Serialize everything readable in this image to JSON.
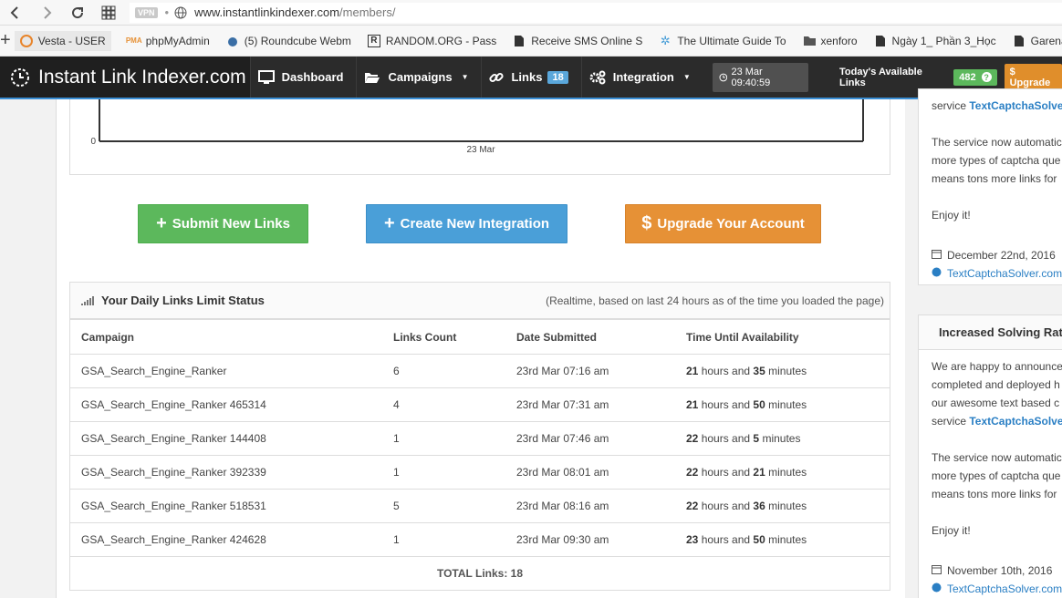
{
  "browser": {
    "vpn_label": "VPN",
    "url_host": "www.instantlinkindexer.com",
    "url_path": "/members/",
    "bookmarks": [
      "Vesta - USER",
      "phpMyAdmin",
      "(5) Roundcube Webm",
      "RANDOM.ORG - Pass",
      "Receive SMS Online S",
      "The Ultimate Guide To",
      "xenforo",
      "Ngày 1_ Phần 3_Học",
      "Garena"
    ]
  },
  "navbar": {
    "brand": "Instant Link Indexer.com",
    "dashboard": "Dashboard",
    "campaigns": "Campaigns",
    "links": "Links",
    "links_count": "18",
    "integration": "Integration",
    "clock": "23 Mar 09:40:59",
    "available_label": "Today's Available Links",
    "available_count": "482",
    "upgrade": "$ Upgrade"
  },
  "chart_data": {
    "type": "area",
    "x": [
      "23 Mar"
    ],
    "y_tick_visible": "0",
    "xlabel_tick": "23 Mar"
  },
  "actions": {
    "submit": "Submit New Links",
    "integration": "Create New Integration",
    "upgrade": "Upgrade Your Account"
  },
  "status": {
    "title": "Your Daily Links Limit Status",
    "note": "(Realtime, based on last 24 hours as of the time you loaded the page)",
    "columns": [
      "Campaign",
      "Links Count",
      "Date Submitted",
      "Time Until Availability"
    ],
    "rows": [
      {
        "campaign": "GSA_Search_Engine_Ranker",
        "count": "6",
        "date": "23rd Mar 07:16 am",
        "h": "21",
        "m": "35"
      },
      {
        "campaign": "GSA_Search_Engine_Ranker 465314",
        "count": "4",
        "date": "23rd Mar 07:31 am",
        "h": "21",
        "m": "50"
      },
      {
        "campaign": "GSA_Search_Engine_Ranker 144408",
        "count": "1",
        "date": "23rd Mar 07:46 am",
        "h": "22",
        "m": "5"
      },
      {
        "campaign": "GSA_Search_Engine_Ranker 392339",
        "count": "1",
        "date": "23rd Mar 08:01 am",
        "h": "22",
        "m": "21"
      },
      {
        "campaign": "GSA_Search_Engine_Ranker 518531",
        "count": "5",
        "date": "23rd Mar 08:16 am",
        "h": "22",
        "m": "36"
      },
      {
        "campaign": "GSA_Search_Engine_Ranker 424628",
        "count": "1",
        "date": "23rd Mar 09:30 am",
        "h": "23",
        "m": "50"
      }
    ],
    "hours_word": "hours and",
    "minutes_word": "minutes",
    "total": "TOTAL Links: 18"
  },
  "news": {
    "card1": {
      "top_line_prefix": "service",
      "top_link": "TextCaptchaSolver",
      "p1": [
        "The service now automatic",
        "more types of captcha que",
        "means tons more links for"
      ],
      "enjoy": "Enjoy it!",
      "date": "December 22nd, 2016",
      "source": "TextCaptchaSolver.com"
    },
    "card2": {
      "title": "Increased Solving Rate",
      "p0": [
        "We are happy to announce",
        "completed and deployed h",
        "our awesome text based c"
      ],
      "service_prefix": "service",
      "service_link": "TextCaptchaSolver",
      "p1": [
        "The service now automatic",
        "more types of captcha que",
        "means tons more links for"
      ],
      "enjoy": "Enjoy it!",
      "date": "November 10th, 2016",
      "source": "TextCaptchaSolver.com"
    }
  },
  "colors": {
    "green": "#5cb85c",
    "blue": "#4a9fd8",
    "orange": "#e69136",
    "link": "#2a7fc4"
  }
}
